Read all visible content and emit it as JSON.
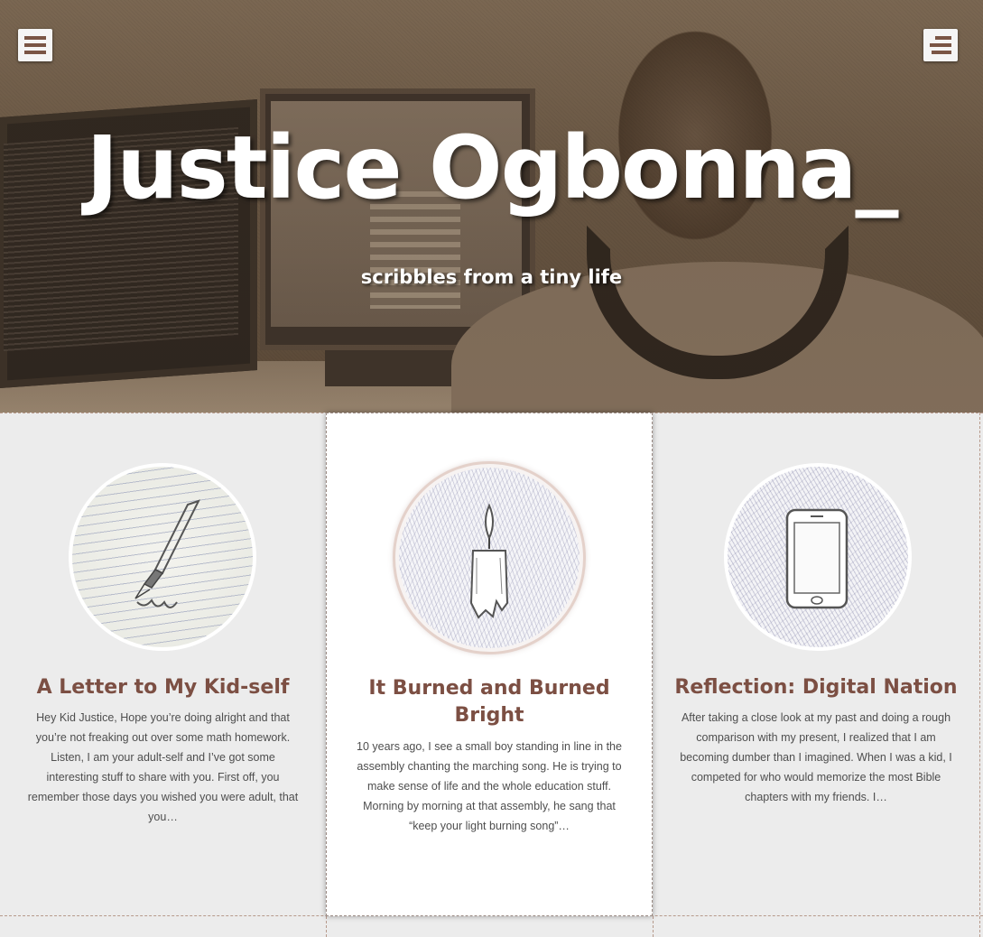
{
  "header": {
    "site_title": "Justice Ogbonna_",
    "tagline": "scribbles from a tiny life"
  },
  "colors": {
    "accent": "#7c4f43",
    "menu_bar": "#7a5545",
    "card_background": "#ffffff",
    "page_background": "#ececec"
  },
  "posts": [
    {
      "title": "A Letter to My Kid-self",
      "excerpt": "Hey Kid Justice, Hope you’re doing alright and that you’re not freaking out over some math homework. Listen, I am your adult-self and I’ve got some interesting stuff to share with you. First off, you remember those days you wished you were adult, that you…",
      "icon": "paintbrush-sketch-icon"
    },
    {
      "title": "It Burned and Burned Bright",
      "excerpt": "10 years ago, I see a small boy standing in line in the assembly chanting the marching song. He is trying to make sense of life and the whole education stuff. Morning by morning at that assembly, he sang that “keep your light burning song”…",
      "icon": "candle-sketch-icon"
    },
    {
      "title": "Reflection: Digital Nation",
      "excerpt": "After taking a close look at my past and doing a rough comparison with my present, I realized that I am becoming dumber than I imagined. When I was a kid, I competed for who would memorize the most Bible chapters with my friends. I…",
      "icon": "smartphone-sketch-icon"
    }
  ]
}
